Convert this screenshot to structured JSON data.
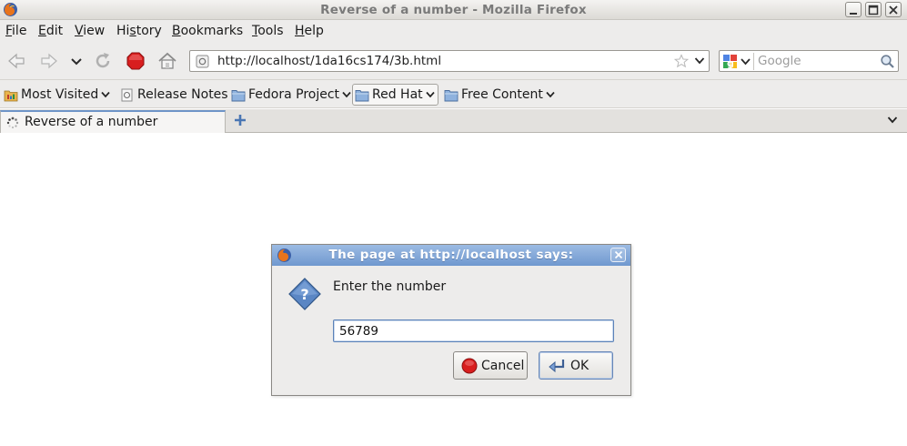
{
  "window": {
    "title": "Reverse of a number - Mozilla Firefox"
  },
  "menu": {
    "items": [
      {
        "label": "File",
        "mnemonic": "F",
        "rest": "ile"
      },
      {
        "label": "Edit",
        "mnemonic": "E",
        "rest": "dit"
      },
      {
        "label": "View",
        "mnemonic": "V",
        "rest": "iew"
      },
      {
        "label": "History",
        "mnemonic": "s",
        "prefix": "Hi",
        "rest": "tory"
      },
      {
        "label": "Bookmarks",
        "mnemonic": "B",
        "rest": "ookmarks"
      },
      {
        "label": "Tools",
        "mnemonic": "T",
        "rest": "ools"
      },
      {
        "label": "Help",
        "mnemonic": "H",
        "rest": "elp"
      }
    ]
  },
  "navigation": {
    "url": "http://localhost/1da16cs174/3b.html",
    "search_placeholder": "Google"
  },
  "bookmarks": {
    "items": [
      {
        "label": "Most Visited",
        "icon": "smart-folder-icon",
        "dropdown": true
      },
      {
        "label": "Release Notes",
        "icon": "page-icon",
        "dropdown": false
      },
      {
        "label": "Fedora Project",
        "icon": "folder-icon",
        "dropdown": true
      },
      {
        "label": "Red Hat",
        "icon": "folder-icon",
        "dropdown": true
      },
      {
        "label": "Free Content",
        "icon": "folder-icon",
        "dropdown": true
      }
    ]
  },
  "tabs": {
    "active_label": "Reverse of a number"
  },
  "dialog": {
    "title": "The page at http://localhost says:",
    "message": "Enter the number",
    "input_value": "56789",
    "cancel_label": "Cancel",
    "ok_label": "OK"
  },
  "colors": {
    "dialog_title_bg": "#7fa4d6",
    "stop_red": "#d81e1e",
    "chrome_bg": "#edeceb"
  }
}
